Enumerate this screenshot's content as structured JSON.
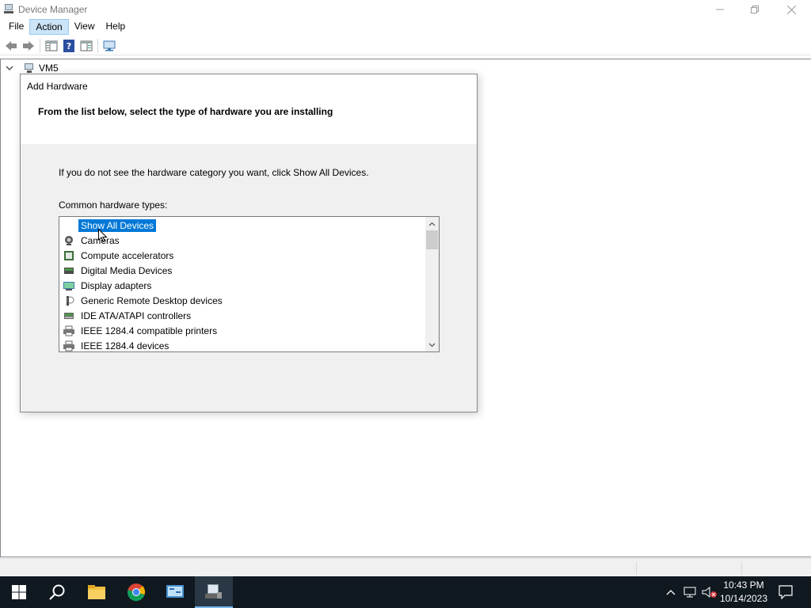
{
  "window": {
    "title": "Device Manager",
    "controls": {
      "minimize": "—",
      "restore": "❐",
      "close": "✕"
    }
  },
  "menu": [
    "File",
    "Action",
    "View",
    "Help"
  ],
  "menu_active": "Action",
  "toolbar": {
    "buttons": [
      "back-icon",
      "forward-icon",
      "properties-icon",
      "help-icon",
      "show-hide-icon",
      "scan-hardware-icon"
    ]
  },
  "tree": {
    "root_label": "VM5",
    "expand_glyph": "⌄"
  },
  "dialog": {
    "title": "Add Hardware",
    "heading": "From the list below, select the type of hardware you are installing",
    "hint": "If you do not see the hardware category you want, click Show All Devices.",
    "list_label": "Common hardware types:",
    "items": [
      {
        "label": "Show All Devices",
        "icon": "none",
        "selected": true
      },
      {
        "label": "Cameras",
        "icon": "camera-icon",
        "selected": false
      },
      {
        "label": "Compute accelerators",
        "icon": "accelerator-icon",
        "selected": false
      },
      {
        "label": "Digital Media Devices",
        "icon": "media-device-icon",
        "selected": false
      },
      {
        "label": "Display adapters",
        "icon": "display-adapter-icon",
        "selected": false
      },
      {
        "label": "Generic Remote Desktop devices",
        "icon": "remote-desktop-icon",
        "selected": false
      },
      {
        "label": "IDE ATA/ATAPI controllers",
        "icon": "ide-controller-icon",
        "selected": false
      },
      {
        "label": "IEEE 1284.4 compatible printers",
        "icon": "printer-icon",
        "selected": false
      },
      {
        "label": "IEEE 1284.4 devices",
        "icon": "ieee-device-icon",
        "selected": false
      }
    ],
    "scroll_position": 0.0
  },
  "taskbar": {
    "pinned": [
      "windows-start-icon",
      "search-icon",
      "file-explorer-icon",
      "chrome-icon",
      "control-panel-icon",
      "device-manager-icon"
    ],
    "active": "device-manager-icon"
  },
  "tray": {
    "time": "10:43 PM",
    "date": "10/14/2023",
    "chevron": "^"
  },
  "colors": {
    "selection": "#0078d7",
    "menu_active_bg": "#cce4f7",
    "taskbar_bg": "#101820",
    "dialog_bg": "#f0f0f0"
  }
}
